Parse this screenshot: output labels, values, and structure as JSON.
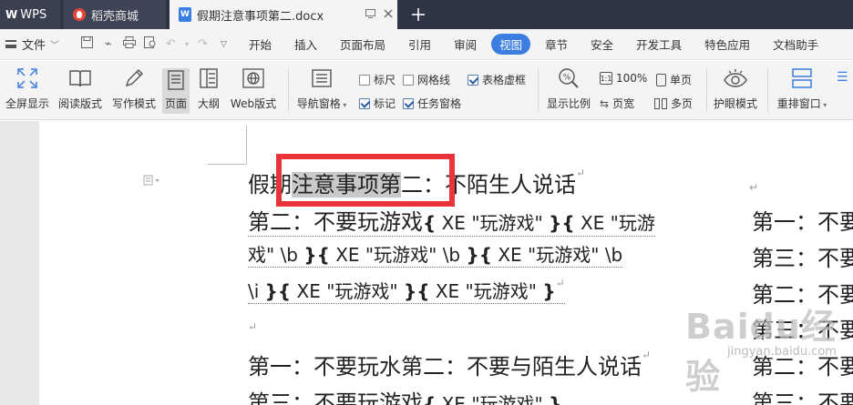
{
  "tabs": {
    "wps": {
      "logo": "W",
      "label": "WPS"
    },
    "store": {
      "label": "稻壳商城"
    },
    "doc": {
      "icon": "W",
      "label": "假期注意事项第二.docx"
    }
  },
  "menu": {
    "file": "文件",
    "items": [
      "开始",
      "插入",
      "页面布局",
      "引用",
      "审阅",
      "视图",
      "章节",
      "安全",
      "开发工具",
      "特色应用",
      "文档助手"
    ],
    "active_index": 5
  },
  "ribbon": {
    "fullscreen": "全屏显示",
    "reading": "阅读版式",
    "writing": "写作模式",
    "page": "页面",
    "outline": "大纲",
    "web": "Web版式",
    "nav_pane": "导航窗格",
    "ruler": "标尺",
    "gridlines": "网格线",
    "table_gridlines": "表格虚框",
    "marks": "标记",
    "task_pane": "任务窗格",
    "zoom": "显示比例",
    "zoom_100": "100%",
    "page_width": "页宽",
    "single_page": "单页",
    "multi_page": "多页",
    "eye_mode": "护眼模式",
    "rearrange": "重排窗口"
  },
  "checkboxes": {
    "ruler": false,
    "gridlines": false,
    "table_gridlines": true,
    "marks": true,
    "task_pane": true
  },
  "document": {
    "line1_pre": "假期",
    "line1_hl": "注意事项第",
    "line1_post": "二：不陌生人说话",
    "line2_text": "第二：不要玩游戏",
    "field_xe": "XE",
    "field_val": "\"玩游戏\"",
    "field_val_split1": "\"玩游",
    "field_val_split2": "戏\"",
    "field_b": "\\b",
    "field_i": "\\i",
    "line5_text": "第一：不要玩水第二：不要与陌生人说话",
    "line6_text": "第三：不要玩游戏"
  },
  "column2": [
    "第一：不要",
    "第三：不要",
    "第二：不要",
    "第三：不要",
    "第二：不要",
    "第三：不要"
  ],
  "watermark": {
    "main": "Baidu经验",
    "sub": "jingyan.baidu.com"
  }
}
